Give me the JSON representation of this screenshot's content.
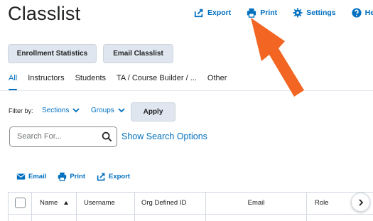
{
  "page": {
    "title": "Classlist"
  },
  "top_actions": [
    {
      "label": "Export",
      "icon": "export-icon"
    },
    {
      "label": "Print",
      "icon": "print-icon"
    },
    {
      "label": "Settings",
      "icon": "gear-icon"
    },
    {
      "label": "Help",
      "icon": "help-icon"
    }
  ],
  "buttons": {
    "enrollment_statistics": "Enrollment Statistics",
    "email_classlist": "Email Classlist",
    "apply": "Apply"
  },
  "tabs": [
    "All",
    "Instructors",
    "Students",
    "TA / Course Builder / ...",
    "Other"
  ],
  "active_tab": "All",
  "filter": {
    "label": "Filter by:",
    "sections": "Sections",
    "groups": "Groups"
  },
  "search": {
    "placeholder": "Search For...",
    "show_options": "Show Search Options"
  },
  "list_actions": [
    {
      "label": "Email",
      "icon": "email-icon"
    },
    {
      "label": "Print",
      "icon": "print-icon"
    },
    {
      "label": "Export",
      "icon": "export-icon"
    }
  ],
  "table": {
    "columns": [
      "Name",
      "Username",
      "Org Defined ID",
      "Email",
      "Role"
    ]
  },
  "colors": {
    "accent": "#006fbf",
    "button_bg": "#dfe6ef",
    "annotation_arrow": "#f26522"
  }
}
